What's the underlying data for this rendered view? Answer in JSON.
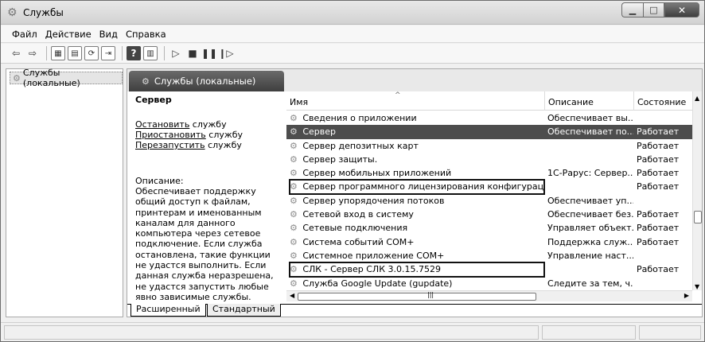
{
  "window": {
    "title": "Службы",
    "btn_minimize": "▁",
    "btn_maximize": "□",
    "btn_close": "✕"
  },
  "menu": [
    "Файл",
    "Действие",
    "Вид",
    "Справка"
  ],
  "toolbar": {
    "icons": [
      "back-arrow-icon",
      "forward-arrow-icon",
      "console-tree-icon",
      "properties-icon",
      "refresh-icon",
      "export-icon",
      "help-icon",
      "view-icon",
      "start-icon",
      "stop-icon",
      "pause-icon",
      "resume-icon"
    ]
  },
  "tree": {
    "root_label": "Службы (локальные)"
  },
  "pane": {
    "tab_label": "Службы (локальные)",
    "selected_service": "Сервер",
    "actions": [
      {
        "link": "Остановить",
        "rest": " службу"
      },
      {
        "link": "Приостановить",
        "rest": " службу"
      },
      {
        "link": "Перезапустить",
        "rest": " службу"
      }
    ],
    "description_label": "Описание:",
    "description_text": "Обеспечивает поддержку общий доступ к файлам, принтерам и именованным каналам для данного компьютера через сетевое подключение. Если служба остановлена, такие функции не удастся выполнить. Если данная служба неразрешена, не удастся запустить любые явно зависимые службы."
  },
  "list": {
    "columns": [
      "Имя",
      "Описание",
      "Состояние"
    ],
    "rows": [
      {
        "name": "Сведения о приложении",
        "desc": "Обеспечивает вы...",
        "state": "",
        "selected": false,
        "boxed": false
      },
      {
        "name": "Сервер",
        "desc": "Обеспечивает по...",
        "state": "Работает",
        "selected": true,
        "boxed": false
      },
      {
        "name": "Сервер депозитных карт",
        "desc": "",
        "state": "Работает",
        "selected": false,
        "boxed": false
      },
      {
        "name": "Сервер защиты.",
        "desc": "",
        "state": "Работает",
        "selected": false,
        "boxed": false
      },
      {
        "name": "Сервер мобильных приложений",
        "desc": "1С-Рарус: Сервер...",
        "state": "Работает",
        "selected": false,
        "boxed": false
      },
      {
        "name": "Сервер программного лицензирования конфигураций",
        "desc": "",
        "state": "Работает",
        "selected": false,
        "boxed": true
      },
      {
        "name": "Сервер упорядочения потоков",
        "desc": "Обеспечивает уп...",
        "state": "",
        "selected": false,
        "boxed": false
      },
      {
        "name": "Сетевой вход в систему",
        "desc": "Обеспечивает без...",
        "state": "Работает",
        "selected": false,
        "boxed": false
      },
      {
        "name": "Сетевые подключения",
        "desc": "Управляет объект...",
        "state": "Работает",
        "selected": false,
        "boxed": false
      },
      {
        "name": "Система событий COM+",
        "desc": "Поддержка служ...",
        "state": "Работает",
        "selected": false,
        "boxed": false
      },
      {
        "name": "Системное приложение COM+",
        "desc": "Управление наст...",
        "state": "",
        "selected": false,
        "boxed": false
      },
      {
        "name": "СЛК - Сервер СЛК 3.0.15.7529",
        "desc": "",
        "state": "Работает",
        "selected": false,
        "boxed": true
      },
      {
        "name": "Служба Google Update (gupdate)",
        "desc": "Следите за тем, ч...",
        "state": "",
        "selected": false,
        "boxed": false
      }
    ]
  },
  "bottom_tabs": [
    "Расширенный",
    "Стандартный"
  ]
}
